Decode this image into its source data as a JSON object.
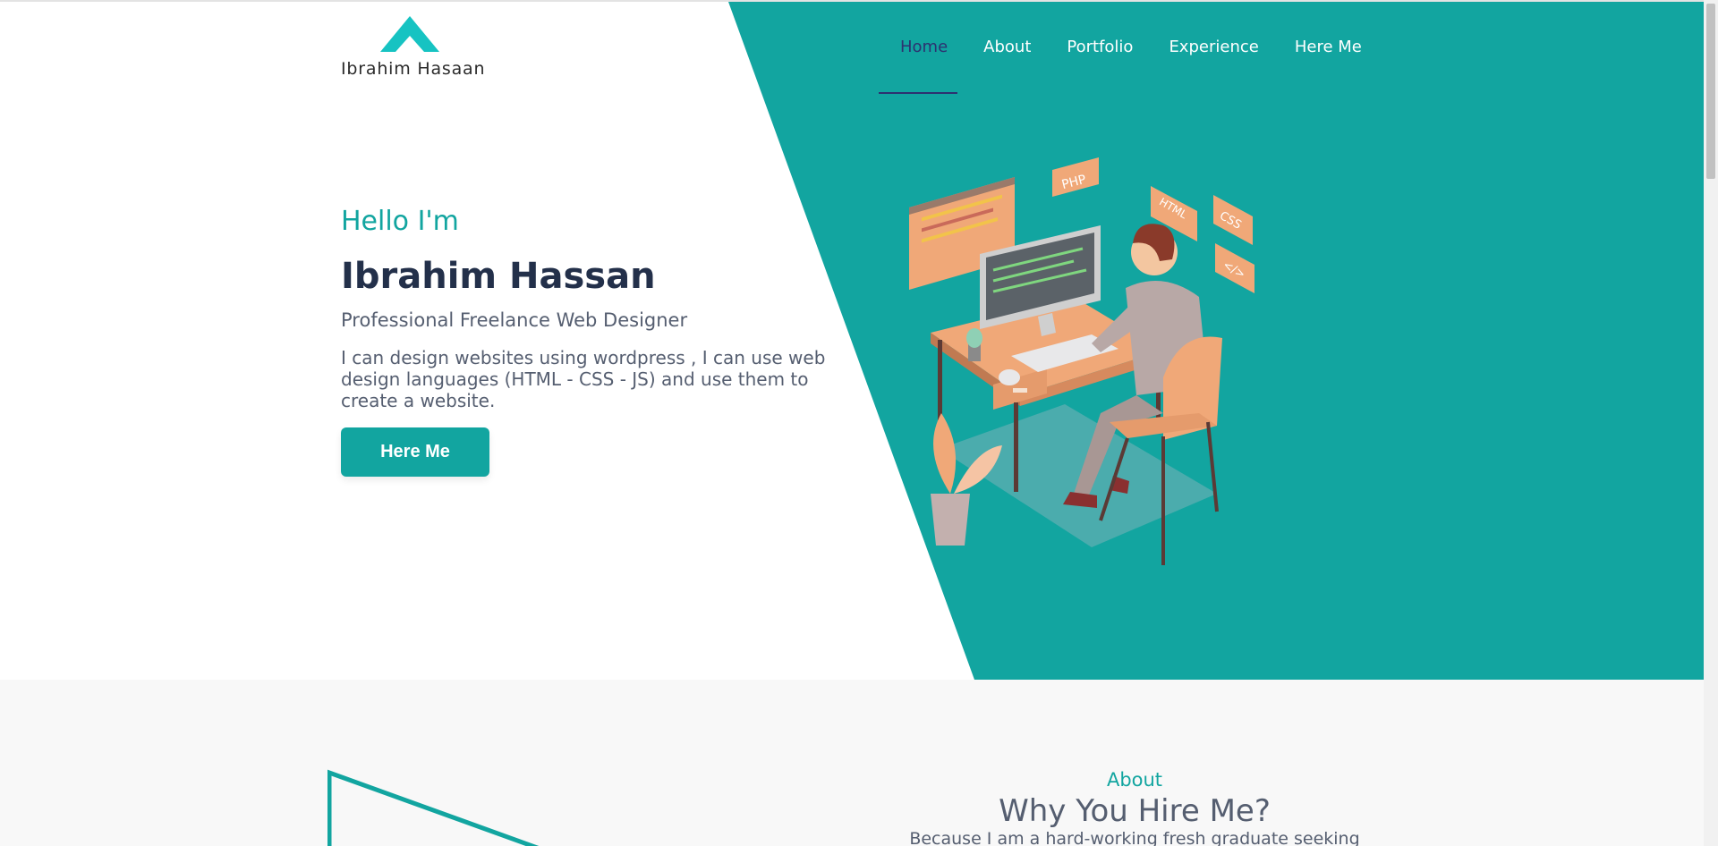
{
  "logo": {
    "text": "Ibrahim Hasaan"
  },
  "nav": {
    "items": [
      {
        "label": "Home",
        "active": true
      },
      {
        "label": "About"
      },
      {
        "label": "Portfolio"
      },
      {
        "label": "Experience"
      },
      {
        "label": "Here Me"
      }
    ]
  },
  "hero": {
    "greeting": "Hello I'm",
    "name": "Ibrahim Hassan",
    "subtitle": "Professional Freelance Web Designer",
    "description": "I can design websites using wordpress , I can use web design languages (HTML - CSS - JS) and use them to create a website.",
    "cta_label": "Here Me",
    "illustration_tags": [
      "PHP",
      "HTML",
      "CSS",
      "</>"
    ]
  },
  "about": {
    "tag": "About",
    "title": "Why You Hire Me?",
    "text": "Because I am a hard-working fresh graduate seeking"
  },
  "colors": {
    "accent": "#12a5a0",
    "heading": "#23304a",
    "body_text": "#555e70",
    "nav_active": "#2d3170"
  }
}
